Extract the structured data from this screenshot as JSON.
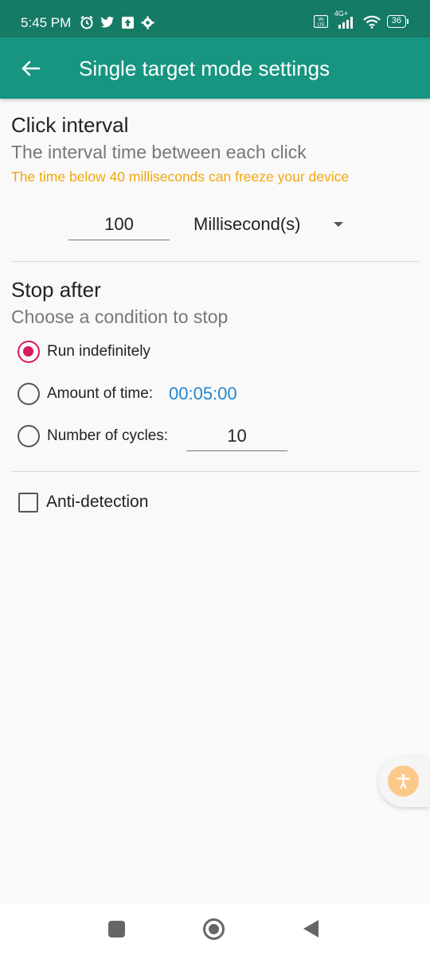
{
  "status_bar": {
    "time": "5:45 PM",
    "left_icons": [
      "alarm-icon",
      "twitter-icon",
      "upload-icon",
      "settings-icon"
    ],
    "right_icons": [
      "volte-icon",
      "signal-icon",
      "wifi-icon",
      "battery-icon"
    ],
    "network": "4G+",
    "volte": "Vo LTE",
    "battery": "36"
  },
  "app_bar": {
    "title": "Single target mode settings",
    "back_icon": "arrow-left-icon",
    "background": "#179580",
    "status_background": "#157a66"
  },
  "click_interval": {
    "title": "Click interval",
    "subtitle": "The interval time between each click",
    "warning": "The time below 40 milliseconds can freeze your device",
    "warning_color": "#f2a70c",
    "value": "100",
    "unit": "Millisecond(s)"
  },
  "stop_after": {
    "title": "Stop after",
    "subtitle": "Choose a condition to stop",
    "options": [
      {
        "label": "Run indefinitely",
        "checked": true
      },
      {
        "label": "Amount of time:",
        "checked": false,
        "value": "00:05:00"
      },
      {
        "label": "Number of cycles:",
        "checked": false,
        "value": "10"
      }
    ],
    "accent_color": "#d81b60",
    "link_color": "#2486d2"
  },
  "anti_detection": {
    "label": "Anti-detection",
    "checked": false
  },
  "fab": {
    "icon": "accessibility-icon",
    "color": "#fbc98a"
  },
  "nav_bar": {
    "icons": [
      "recents-icon",
      "home-icon",
      "back-icon"
    ]
  }
}
